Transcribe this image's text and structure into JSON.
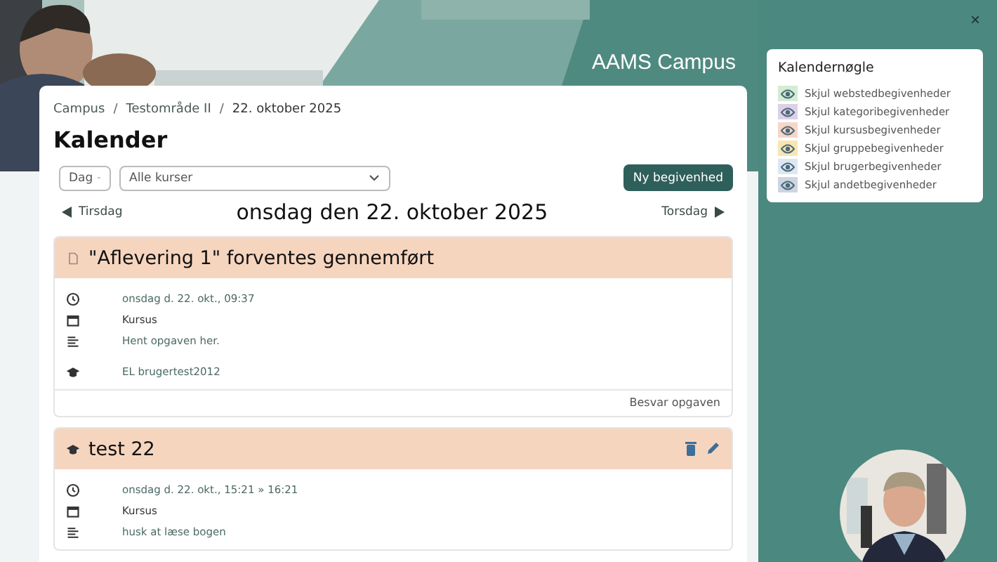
{
  "header": {
    "site_title": "AAMS Campus"
  },
  "breadcrumb": {
    "separator": "/",
    "items": [
      "Campus",
      "Testområde II",
      "22. oktober 2025"
    ]
  },
  "page_title": "Kalender",
  "controls": {
    "view_select": "Dag",
    "course_select": "Alle kurser",
    "new_event_button": "Ny begivenhed"
  },
  "day_nav": {
    "previous": "Tirsdag",
    "current": "onsdag den 22. oktober 2025",
    "next": "Torsdag"
  },
  "events": [
    {
      "kind": "assignment",
      "title": "\"Aflevering 1\" forventes gennemført",
      "editable": false,
      "details": [
        {
          "kind": "time",
          "text": "onsdag d. 22. okt., 09:37"
        },
        {
          "kind": "type",
          "text": "Kursus"
        },
        {
          "kind": "description",
          "text": "Hent opgaven her."
        },
        {
          "kind": "course",
          "text": "EL brugertest2012"
        }
      ],
      "action": "Besvar opgaven"
    },
    {
      "kind": "course",
      "title": "test 22",
      "editable": true,
      "details": [
        {
          "kind": "time",
          "text": "onsdag d. 22. okt., 15:21 » 16:21"
        },
        {
          "kind": "type",
          "text": "Kursus"
        },
        {
          "kind": "description",
          "text": "husk at læse bogen"
        }
      ]
    }
  ],
  "legend": {
    "title": "Kalendernøgle",
    "items": [
      {
        "label": "Skjul webstedbegivenheder",
        "color": "#d3ecd3"
      },
      {
        "label": "Skjul kategoribegivenheder",
        "color": "#ddd0e8"
      },
      {
        "label": "Skjul kursusbegivenheder",
        "color": "#f7d6c9"
      },
      {
        "label": "Skjul gruppebegivenheder",
        "color": "#f8e6b2"
      },
      {
        "label": "Skjul brugerbegivenheder",
        "color": "#dde7f3"
      },
      {
        "label": "Skjul andetbegivenheder",
        "color": "#cdd5e2"
      }
    ]
  },
  "drawer": {
    "close": "×"
  }
}
